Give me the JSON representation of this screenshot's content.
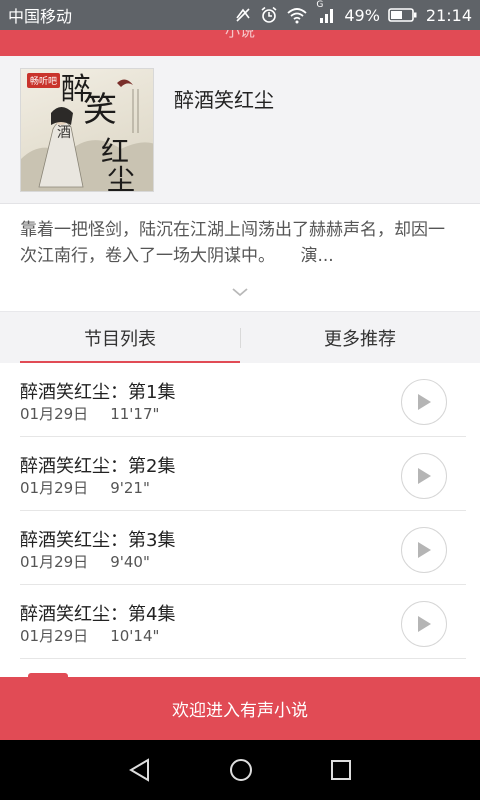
{
  "status_bar": {
    "carrier": "中国移动",
    "network_type": "G",
    "battery": "49%",
    "time": "21:14"
  },
  "header": {
    "title": "小说"
  },
  "book": {
    "cover_badge": "畅听吧",
    "title": "醉酒笑红尘",
    "description": "靠着一把怪剑，陆沉在江湖上闯荡出了赫赫声名，却因一次江南行，卷入了一场大阴谋中。　　演..."
  },
  "tabs": [
    {
      "label": "节目列表",
      "active": true
    },
    {
      "label": "更多推荐",
      "active": false
    }
  ],
  "episodes": [
    {
      "title": "醉酒笑红尘：第1集",
      "date": "01月29日",
      "duration": "11'17\""
    },
    {
      "title": "醉酒笑红尘：第2集",
      "date": "01月29日",
      "duration": "9'21\""
    },
    {
      "title": "醉酒笑红尘：第3集",
      "date": "01月29日",
      "duration": "9'40\""
    },
    {
      "title": "醉酒笑红尘：第4集",
      "date": "01月29日",
      "duration": "10'14\""
    }
  ],
  "banner": {
    "text": "欢迎进入有声小说"
  },
  "colors": {
    "accent": "#e14b55",
    "status_bar": "#5f6368",
    "panel": "#f3f3f5"
  },
  "icons": [
    "silent-mode-icon",
    "alarm-icon",
    "wifi-icon",
    "signal-icon",
    "battery-icon",
    "chevron-down-icon",
    "play-icon",
    "back-icon",
    "home-icon",
    "recents-icon"
  ]
}
